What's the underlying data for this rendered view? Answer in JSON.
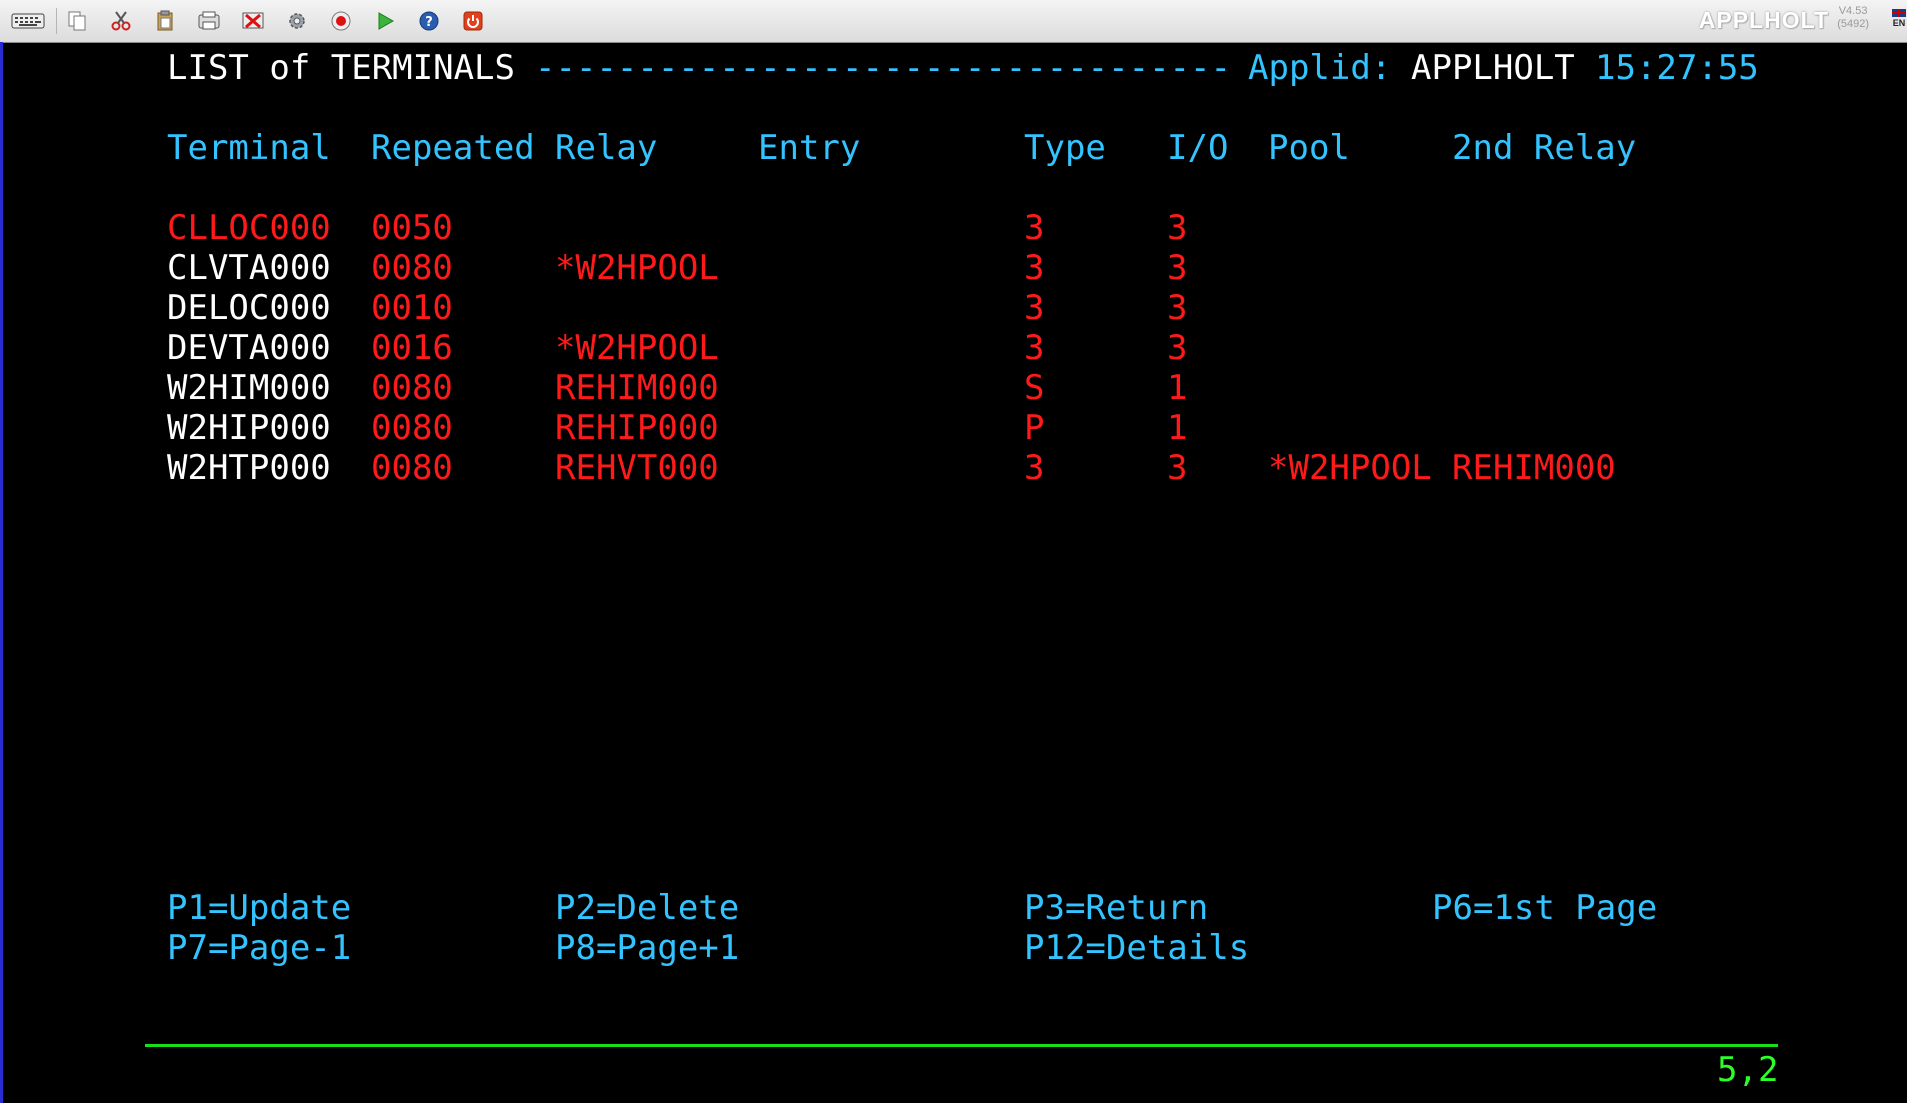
{
  "toolbar": {
    "buttons": [
      {
        "icon": "keyboard-icon"
      },
      {
        "icon": "copy-icon"
      },
      {
        "icon": "cut-icon"
      },
      {
        "icon": "paste-icon"
      },
      {
        "icon": "print-screen-icon"
      },
      {
        "icon": "disconnect-icon"
      },
      {
        "icon": "settings-icon"
      },
      {
        "icon": "record-icon"
      },
      {
        "icon": "play-icon"
      },
      {
        "icon": "help-icon"
      },
      {
        "icon": "power-icon"
      }
    ],
    "brand": "APPLHOLT",
    "version": "V4.53",
    "build": "(5492)",
    "lang": "EN"
  },
  "header": {
    "title": "LIST of TERMINALS",
    "dashes": "----------------------------------",
    "applid_label": "Applid:",
    "applid_value": "APPLHOLT",
    "time": "15:27:55"
  },
  "columns": {
    "terminal": "Terminal",
    "repeated": "Repeated",
    "relay": "Relay",
    "entry": "Entry",
    "type": "Type",
    "io": "I/O",
    "pool": "Pool",
    "relay2": "2nd Relay"
  },
  "rows": [
    {
      "terminal": "CLLOC000",
      "repeated": "0050",
      "relay": "",
      "entry": "",
      "type": "3",
      "io": "3",
      "pool": "",
      "relay2": ""
    },
    {
      "terminal": "CLVTA000",
      "repeated": "0080",
      "relay": "*W2HPOOL",
      "entry": "",
      "type": "3",
      "io": "3",
      "pool": "",
      "relay2": ""
    },
    {
      "terminal": "DELOC000",
      "repeated": "0010",
      "relay": "",
      "entry": "",
      "type": "3",
      "io": "3",
      "pool": "",
      "relay2": ""
    },
    {
      "terminal": "DEVTA000",
      "repeated": "0016",
      "relay": "*W2HPOOL",
      "entry": "",
      "type": "3",
      "io": "3",
      "pool": "",
      "relay2": ""
    },
    {
      "terminal": "W2HIM000",
      "repeated": "0080",
      "relay": "REHIM000",
      "entry": "",
      "type": "S",
      "io": "1",
      "pool": "",
      "relay2": ""
    },
    {
      "terminal": "W2HIP000",
      "repeated": "0080",
      "relay": "REHIP000",
      "entry": "",
      "type": "P",
      "io": "1",
      "pool": "",
      "relay2": ""
    },
    {
      "terminal": "W2HTP000",
      "repeated": "0080",
      "relay": "REHVT000",
      "entry": "",
      "type": "3",
      "io": "3",
      "pool": "*W2HPOOL",
      "relay2": "REHIM000"
    }
  ],
  "pfkeys": {
    "p1": "P1=Update",
    "p2": "P2=Delete",
    "p3": "P3=Return",
    "p6": "P6=1st Page",
    "p7": "P7=Page-1",
    "p8": "P8=Page+1",
    "p12": "P12=Details"
  },
  "status": {
    "cursor": "5,2"
  },
  "colors": {
    "field_label": "#33c3ff",
    "field_value": "#ffffff",
    "field_data": "#ff1a1a",
    "status": "#2aff2a",
    "background": "#000000"
  }
}
